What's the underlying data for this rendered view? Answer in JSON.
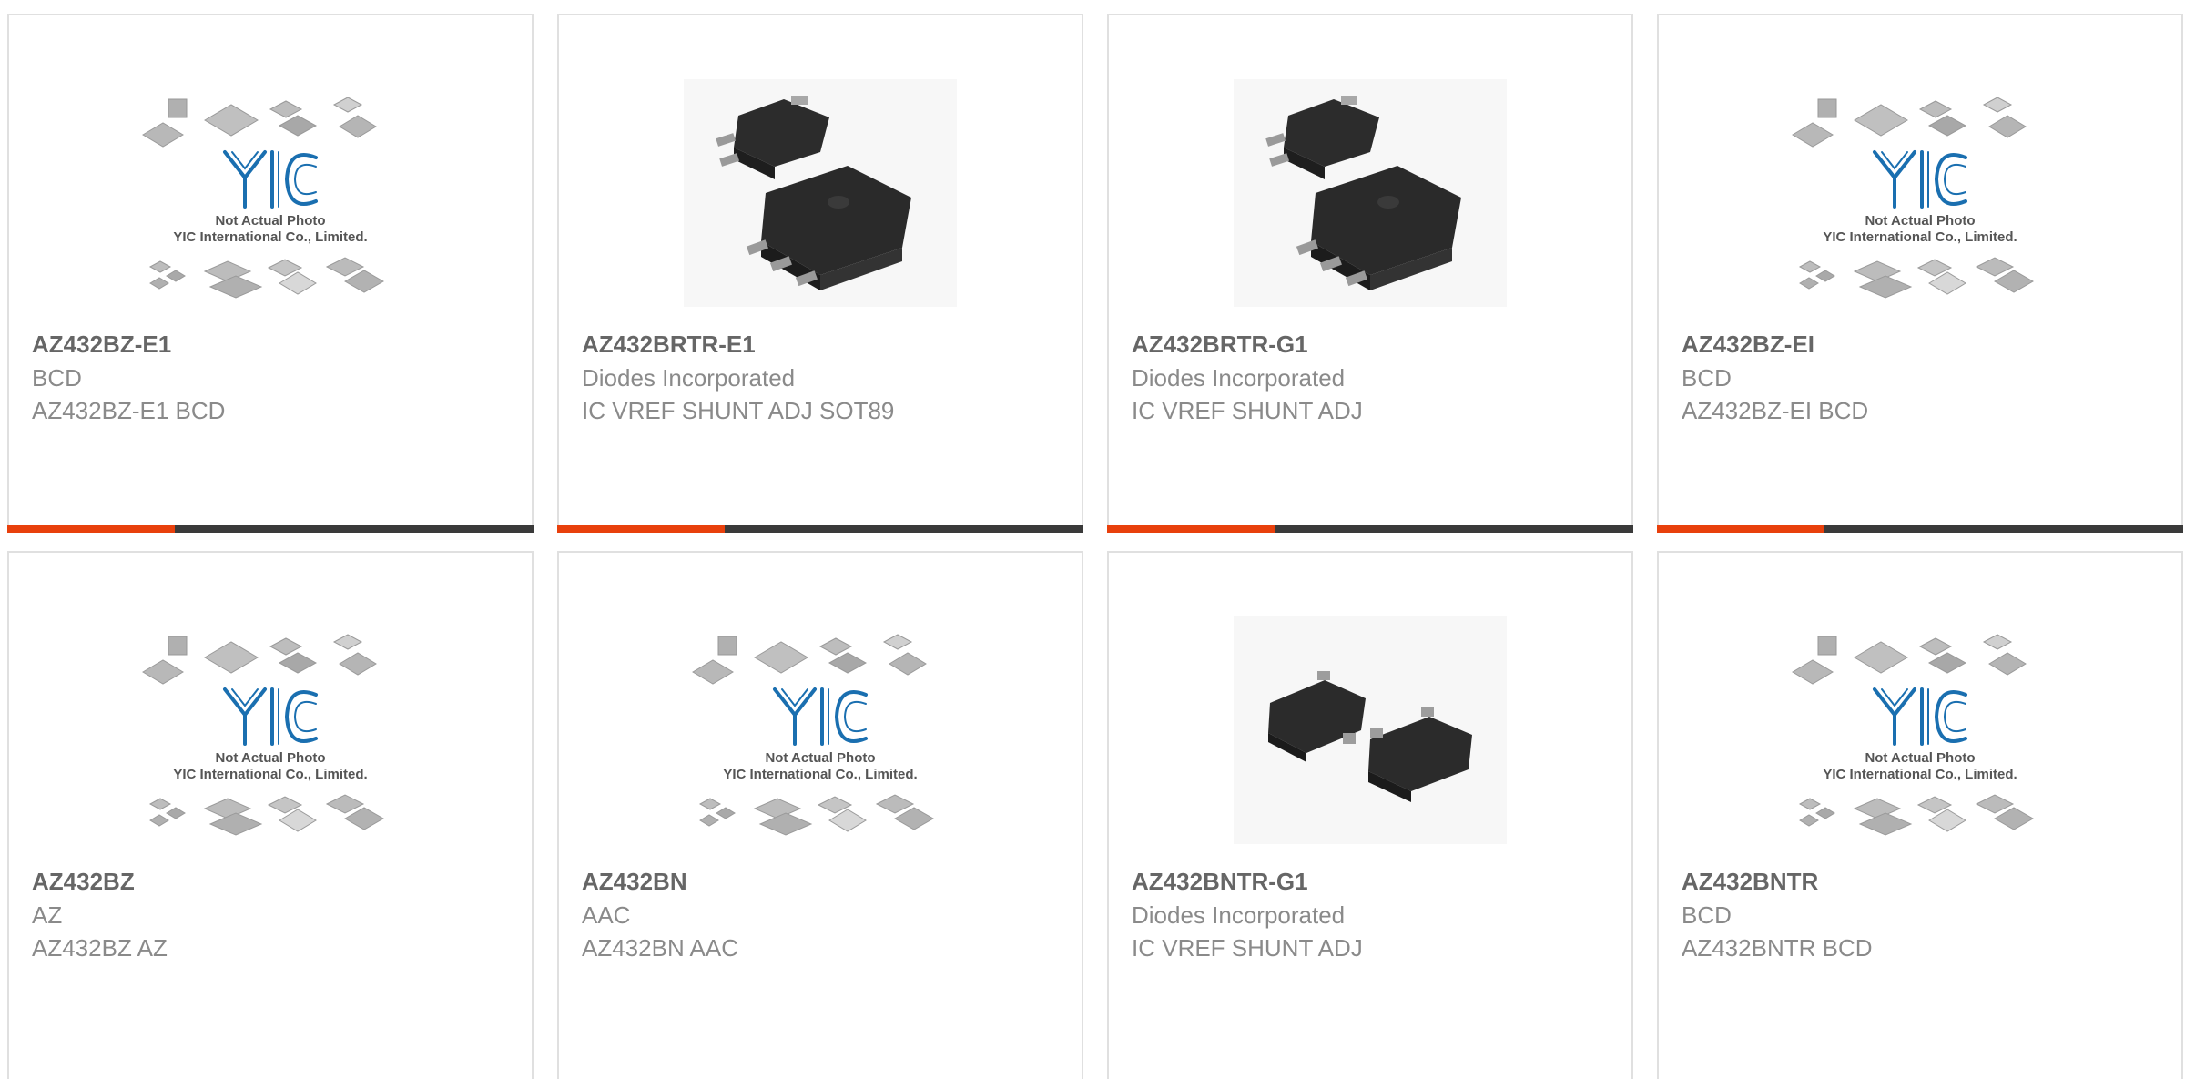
{
  "products": [
    {
      "part": "AZ432BZ-E1",
      "manufacturer": "BCD",
      "description": "AZ432BZ-E1 BCD",
      "image": "placeholder-logo"
    },
    {
      "part": "AZ432BRTR-E1",
      "manufacturer": "Diodes Incorporated",
      "description": "IC VREF SHUNT ADJ SOT89",
      "image": "sot89-chip"
    },
    {
      "part": "AZ432BRTR-G1",
      "manufacturer": "Diodes Incorporated",
      "description": "IC VREF SHUNT ADJ",
      "image": "sot89-chip"
    },
    {
      "part": "AZ432BZ-EI",
      "manufacturer": "BCD",
      "description": "AZ432BZ-EI BCD",
      "image": "placeholder-logo"
    },
    {
      "part": "AZ432BZ",
      "manufacturer": "AZ",
      "description": "AZ432BZ AZ",
      "image": "placeholder-logo"
    },
    {
      "part": "AZ432BN",
      "manufacturer": "AAC",
      "description": "AZ432BN AAC",
      "image": "placeholder-logo"
    },
    {
      "part": "AZ432BNTR-G1",
      "manufacturer": "Diodes Incorporated",
      "description": "IC VREF SHUNT ADJ",
      "image": "sot23-chip"
    },
    {
      "part": "AZ432BNTR",
      "manufacturer": "BCD",
      "description": "AZ432BNTR BCD",
      "image": "placeholder-logo"
    }
  ],
  "placeholder": {
    "logo_text": "YIC",
    "line1": "Not Actual Photo",
    "line2": "YIC International Co., Limited."
  },
  "colors": {
    "accent": "#e8400c",
    "bar": "#3a3a3a",
    "logo": "#1a6fb0",
    "text_title": "#666666",
    "text_body": "#8a8a8a"
  }
}
